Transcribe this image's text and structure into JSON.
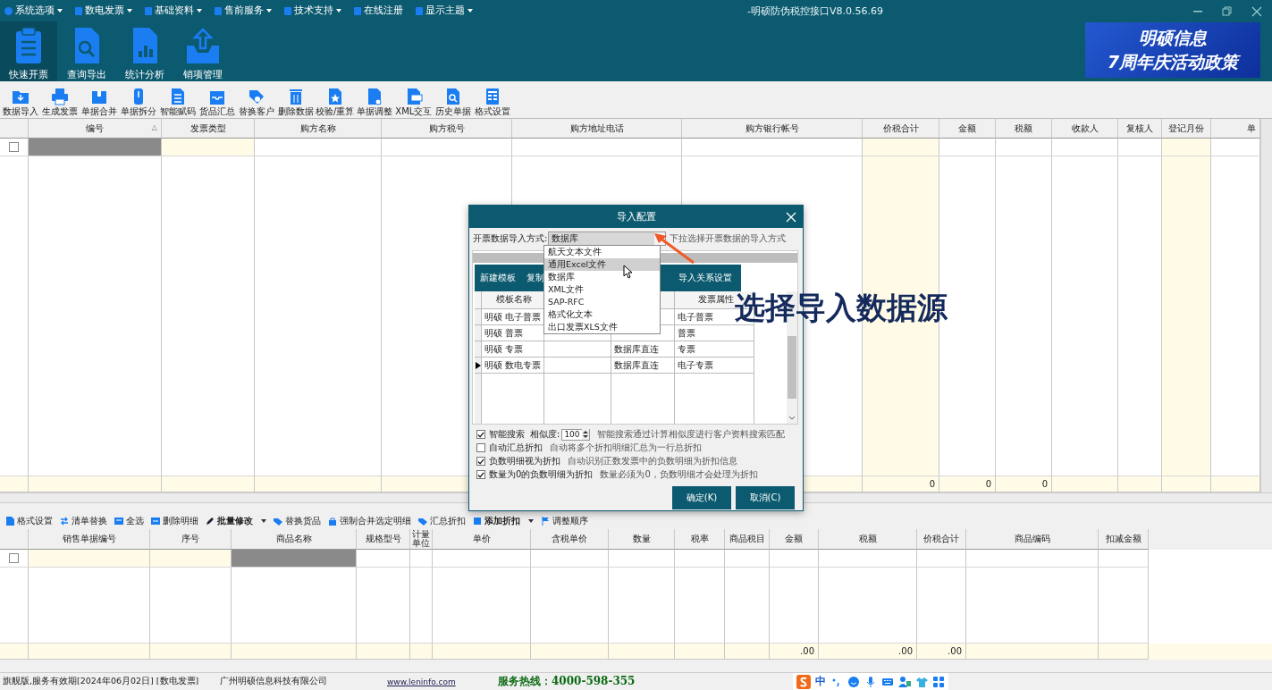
{
  "window": {
    "title": "-明硕防伪税控接口V8.0.56.69"
  },
  "menu": [
    {
      "label": "系统选项",
      "has_menu": true
    },
    {
      "label": "数电发票",
      "has_menu": true
    },
    {
      "label": "基础资料",
      "has_menu": true
    },
    {
      "label": "售前服务",
      "has_menu": true
    },
    {
      "label": "技术支持",
      "has_menu": true
    },
    {
      "label": "在线注册",
      "has_menu": false
    },
    {
      "label": "显示主题",
      "has_menu": true
    }
  ],
  "big_tools": [
    {
      "label": "快速开票",
      "selected": true
    },
    {
      "label": "查询导出",
      "selected": false
    },
    {
      "label": "统计分析",
      "selected": false
    },
    {
      "label": "销项管理",
      "selected": false
    }
  ],
  "banner": {
    "line_1": "明硕信息",
    "line_2": "7周年庆活动政策"
  },
  "toolbar": [
    {
      "label": "数据导入"
    },
    {
      "label": "生成发票"
    },
    {
      "label": "单据合并"
    },
    {
      "label": "单据拆分"
    },
    {
      "label": "智能赋码"
    },
    {
      "label": "货品汇总"
    },
    {
      "label": "替换客户"
    },
    {
      "label": "删除数据"
    },
    {
      "label": "校验/重算"
    },
    {
      "label": "单据调整"
    },
    {
      "label": "XML交互"
    },
    {
      "label": "历史单据"
    },
    {
      "label": "格式设置"
    }
  ],
  "invoice_table": {
    "new_row": {
      "checked": false
    },
    "columns": [
      {
        "label": "编号",
        "sort_mark": "△",
        "selected": true,
        "required": false,
        "highlight": false
      },
      {
        "label": "发票类型",
        "selected": false,
        "required": true,
        "highlight": false
      },
      {
        "label": "购方名称",
        "selected": false,
        "required": false,
        "highlight": false
      },
      {
        "label": "购方税号",
        "selected": false,
        "required": false,
        "highlight": false
      },
      {
        "label": "购方地址电话",
        "selected": false,
        "required": false,
        "highlight": false
      },
      {
        "label": "购方银行帐号",
        "selected": false,
        "required": false,
        "highlight": false
      },
      {
        "label": "价税合计",
        "selected": false,
        "required": false,
        "highlight": true,
        "total": "0"
      },
      {
        "label": "金额",
        "selected": false,
        "required": false,
        "highlight": false,
        "total": "0"
      },
      {
        "label": "税额",
        "selected": false,
        "required": false,
        "highlight": false,
        "total": "0"
      },
      {
        "label": "收款人",
        "selected": false,
        "required": false,
        "highlight": false
      },
      {
        "label": "复核人",
        "selected": false,
        "required": false,
        "highlight": false
      },
      {
        "label": "登记月份",
        "selected": false,
        "required": false,
        "highlight": true
      },
      {
        "label": "单",
        "selected": false,
        "required": false,
        "highlight": false
      }
    ]
  },
  "detail_toolbar": [
    {
      "label": "格式设置",
      "has_menu": false
    },
    {
      "label": "清单替换",
      "has_menu": false
    },
    {
      "label": "全选",
      "has_menu": false
    },
    {
      "label": "删除明细",
      "has_menu": false
    },
    {
      "label": "批量修改",
      "has_menu": true
    },
    {
      "label": "替换货品",
      "has_menu": false
    },
    {
      "label": "强制合并选定明细",
      "has_menu": false
    },
    {
      "label": "汇总折扣",
      "has_menu": false
    },
    {
      "label": "添加折扣",
      "has_menu": true
    },
    {
      "label": "调整顺序",
      "has_menu": false
    }
  ],
  "detail_table": {
    "new_row": {
      "checked": false
    },
    "columns": [
      {
        "label": "销售单据编号",
        "selected": false,
        "required": true,
        "highlight": false
      },
      {
        "label": "序号",
        "selected": false,
        "required": true,
        "highlight": false
      },
      {
        "label": "商品名称",
        "selected": true,
        "required": false,
        "highlight": false
      },
      {
        "label": "规格型号",
        "selected": false,
        "required": false,
        "highlight": false
      },
      {
        "label": "计量单位",
        "selected": false,
        "required": false,
        "highlight": false
      },
      {
        "label": "单价",
        "selected": false,
        "required": false,
        "highlight": false
      },
      {
        "label": "含税单价",
        "selected": false,
        "required": false,
        "highlight": false
      },
      {
        "label": "数量",
        "selected": false,
        "required": false,
        "highlight": false
      },
      {
        "label": "税率",
        "selected": false,
        "required": false,
        "highlight": false
      },
      {
        "label": "商品税目",
        "selected": false,
        "required": false,
        "highlight": false
      },
      {
        "label": "金额",
        "selected": false,
        "required": false,
        "highlight": false,
        "total": ".00"
      },
      {
        "label": "税额",
        "selected": false,
        "required": false,
        "highlight": false,
        "total": ".00"
      },
      {
        "label": "价税合计",
        "selected": false,
        "required": false,
        "highlight": false,
        "total": ".00"
      },
      {
        "label": "商品编码",
        "selected": false,
        "required": false,
        "highlight": false
      },
      {
        "label": "扣减金额",
        "selected": false,
        "required": false,
        "highlight": false
      }
    ]
  },
  "dialog": {
    "title": "导入配置",
    "import_label": "开票数据导入方式:",
    "import_value": "数据库",
    "import_hint": "下拉选择开票数据的导入方式",
    "import_options": [
      {
        "label": "航天文本文件",
        "selected": false
      },
      {
        "label": "通用Excel文件",
        "selected": true
      },
      {
        "label": "数据库",
        "selected": false
      },
      {
        "label": "XML文件",
        "selected": false
      },
      {
        "label": "SAP-RFC",
        "selected": false
      },
      {
        "label": "格式化文本",
        "selected": false
      },
      {
        "label": "出口发票XLS文件",
        "selected": false
      }
    ],
    "template_toolbar": [
      "新建模板",
      "复制",
      "导入关系设置"
    ],
    "template_table": {
      "name_heading": "模板名称",
      "attribute_heading": "发票属性",
      "rows": [
        {
          "name": "明硕 电子普票",
          "attribute": "电子普票",
          "current": false
        },
        {
          "name": "明硕 普票",
          "attribute": "普票",
          "current": false
        },
        {
          "name": "明硕 专票",
          "source": "数据库直连",
          "attribute": "专票",
          "current": false
        },
        {
          "name": "明硕 数电专票",
          "source": "数据库直连",
          "attribute": "电子专票",
          "current": true
        }
      ]
    },
    "options": [
      {
        "label": "智能搜索",
        "checked": true,
        "similarity_label": "相似度:",
        "similarity": "100",
        "hint": "智能搜索通过计算相似度进行客户资料搜索匹配"
      },
      {
        "label": "自动汇总折扣",
        "checked": false,
        "hint": "自动将多个折扣明细汇总为一行总折扣"
      },
      {
        "label": "负数明细视为折扣",
        "checked": true,
        "hint": "自动识别正数发票中的负数明细为折扣信息"
      },
      {
        "label": "数量为0的负数明细为折扣",
        "checked": true,
        "hint": "数量必须为0，负数明细才会处理为折扣"
      }
    ],
    "buttons": [
      "确定(K)",
      "取消(C)"
    ]
  },
  "annotation": {
    "text": "选择导入数据源"
  },
  "status_bar": {
    "edition": "旗舰版,服务有效期[2024年06月02日] [数电发票]",
    "company": "广州明硕信息科技有限公司",
    "website": "www.leninfo.com",
    "hotline": "服务热线：4000-598-355",
    "ime_mode": "中"
  }
}
